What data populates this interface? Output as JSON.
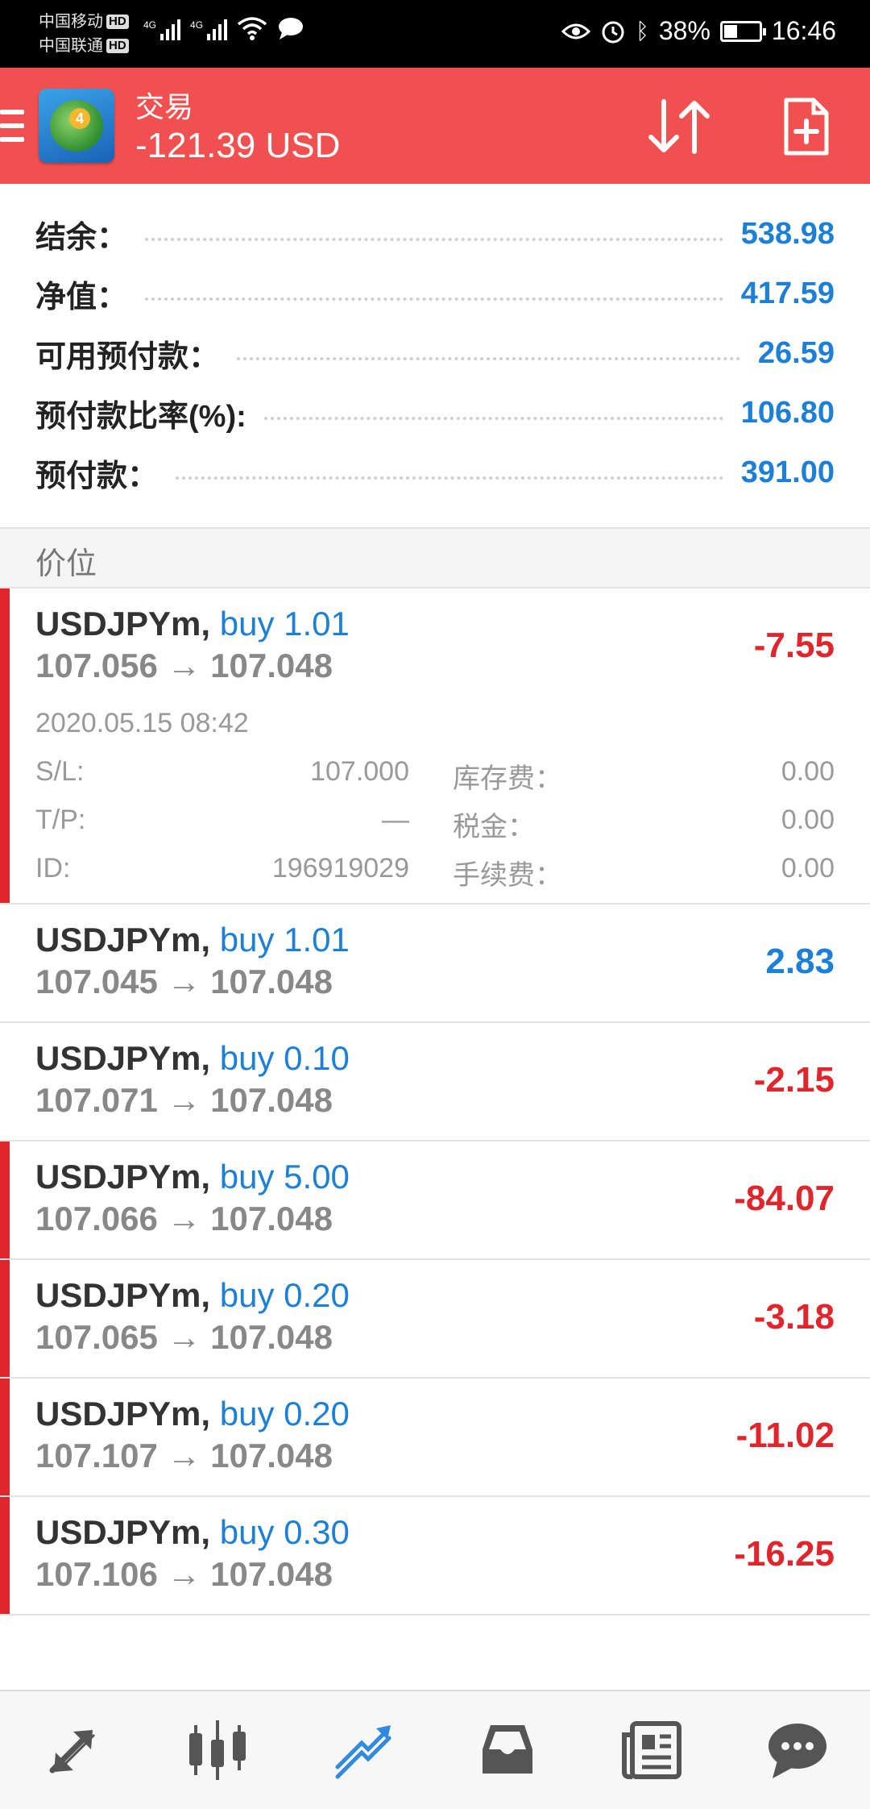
{
  "status_bar": {
    "carrier_1": "中国移动",
    "carrier_2": "中国联通",
    "hd": "HD",
    "net_1": "4G",
    "net_2": "4G",
    "battery_percent": "38%",
    "battery_level": 0.38,
    "time": "16:46"
  },
  "header": {
    "title": "交易",
    "balance": "-121.39 USD",
    "logo_badge": "4",
    "accent_color": "#f15050"
  },
  "summary": [
    {
      "label": "结余：",
      "value": "538.98"
    },
    {
      "label": "净值：",
      "value": "417.59"
    },
    {
      "label": "可用预付款：",
      "value": "26.59"
    },
    {
      "label": "预付款比率(%):",
      "value": "106.80"
    },
    {
      "label": "预付款：",
      "value": "391.00"
    }
  ],
  "section_title": "价位",
  "positions": [
    {
      "symbol": "USDJPYm,",
      "type": "buy 1.01",
      "prices": "107.056 → 107.048",
      "profit": "-7.55",
      "loss": true,
      "expanded": true,
      "time": "2020.05.15 08:42",
      "details": [
        {
          "label": "S/L:",
          "value": "107.000",
          "label2": "库存费：",
          "value2": "0.00"
        },
        {
          "label": "T/P:",
          "value": "—",
          "label2": "税金：",
          "value2": "0.00"
        },
        {
          "label": "ID:",
          "value": "196919029",
          "label2": "手续费：",
          "value2": "0.00"
        }
      ]
    },
    {
      "symbol": "USDJPYm,",
      "type": "buy 1.01",
      "prices": "107.045 → 107.048",
      "profit": "2.83",
      "loss": false
    },
    {
      "symbol": "USDJPYm,",
      "type": "buy 0.10",
      "prices": "107.071 → 107.048",
      "profit": "-2.15",
      "loss": false
    },
    {
      "symbol": "USDJPYm,",
      "type": "buy 5.00",
      "prices": "107.066 → 107.048",
      "profit": "-84.07",
      "loss": true
    },
    {
      "symbol": "USDJPYm,",
      "type": "buy 0.20",
      "prices": "107.065 → 107.048",
      "profit": "-3.18",
      "loss": true
    },
    {
      "symbol": "USDJPYm,",
      "type": "buy 0.20",
      "prices": "107.107 → 107.048",
      "profit": "-11.02",
      "loss": true
    },
    {
      "symbol": "USDJPYm,",
      "type": "buy 0.30",
      "prices": "107.106 → 107.048",
      "profit": "-16.25",
      "loss": true
    }
  ],
  "bottom_nav": [
    {
      "name": "nav-quotes",
      "icon": "arrows-diagonal-icon",
      "active": false
    },
    {
      "name": "nav-chart",
      "icon": "candlestick-icon",
      "active": false
    },
    {
      "name": "nav-trade",
      "icon": "trend-lines-icon",
      "active": true
    },
    {
      "name": "nav-history",
      "icon": "inbox-tray-icon",
      "active": false
    },
    {
      "name": "nav-news",
      "icon": "newspaper-icon",
      "active": false
    },
    {
      "name": "nav-chat",
      "icon": "chat-bubble-icon",
      "active": false
    }
  ]
}
